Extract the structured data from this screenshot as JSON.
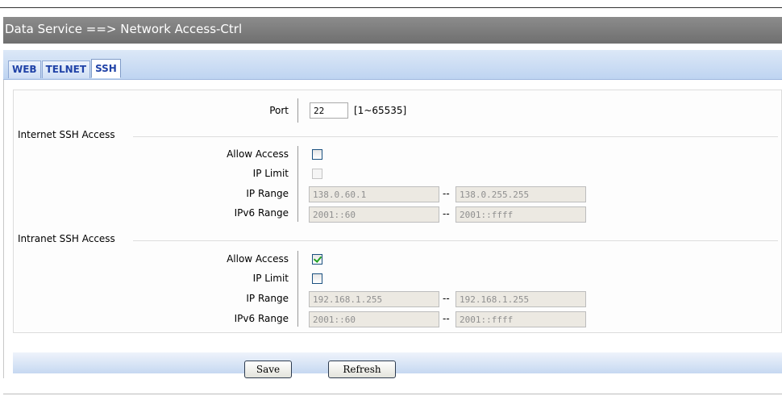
{
  "header": {
    "title": "Data Service ==> Network Access-Ctrl"
  },
  "tabs": [
    {
      "label": "WEB",
      "active": false
    },
    {
      "label": "TELNET",
      "active": false
    },
    {
      "label": "SSH",
      "active": true
    }
  ],
  "port": {
    "label": "Port",
    "value": "22",
    "range_hint": "[1~65535]"
  },
  "internet": {
    "title": "Internet SSH Access",
    "allow_access_label": "Allow Access",
    "allow_access_checked": false,
    "ip_limit_label": "IP Limit",
    "ip_limit_checked": false,
    "ip_range_label": "IP Range",
    "ip_range_start": "138.0.60.1",
    "ip_range_end": "138.0.255.255",
    "ipv6_range_label": "IPv6 Range",
    "ipv6_range_start": "2001::60",
    "ipv6_range_end": "2001::ffff"
  },
  "intranet": {
    "title": "Intranet SSH Access",
    "allow_access_label": "Allow Access",
    "allow_access_checked": true,
    "ip_limit_label": "IP Limit",
    "ip_limit_checked": false,
    "ip_range_label": "IP Range",
    "ip_range_start": "192.168.1.255",
    "ip_range_end": "192.168.1.255",
    "ipv6_range_label": "IPv6 Range",
    "ipv6_range_start": "2001::60",
    "ipv6_range_end": "2001::ffff"
  },
  "range_separator": "--",
  "buttons": {
    "save_label": "Save",
    "refresh_label": "Refresh"
  },
  "colors": {
    "title_bar": "#7f7f7f",
    "tab_text": "#2143a7",
    "check_mark": "#21a121"
  }
}
